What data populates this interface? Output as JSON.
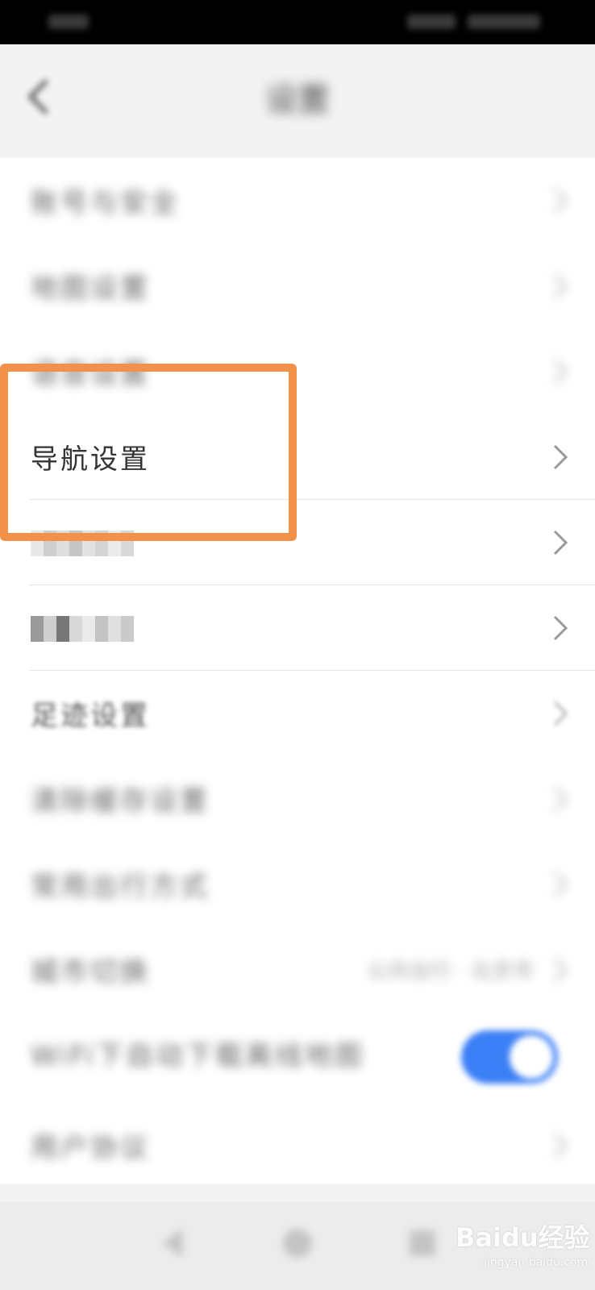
{
  "header": {
    "title": "设置"
  },
  "settings": [
    {
      "label": "账号与安全",
      "value": ""
    },
    {
      "label": "地图设置",
      "value": ""
    },
    {
      "label": "语音设置",
      "value": ""
    },
    {
      "label": "导航设置",
      "value": ""
    },
    {
      "label": "",
      "value": ""
    },
    {
      "label": "",
      "value": ""
    },
    {
      "label": "足迹设置",
      "value": ""
    },
    {
      "label": "清除缓存设置",
      "value": ""
    },
    {
      "label": "常用出行方式",
      "value": ""
    },
    {
      "label": "城市切换",
      "value": "公共出行 · 北京市"
    }
  ],
  "settings2": [
    {
      "label": "WiFi下自动下载离线地图"
    },
    {
      "label": "用户协议"
    }
  ],
  "toggle": {
    "state": "on",
    "color": "#3b7ff6"
  },
  "highlight": {
    "target": "导航设置",
    "color": "#f2914a"
  },
  "watermark": {
    "logo": "Baidu经验",
    "url": "jingyan.baidu.com"
  }
}
